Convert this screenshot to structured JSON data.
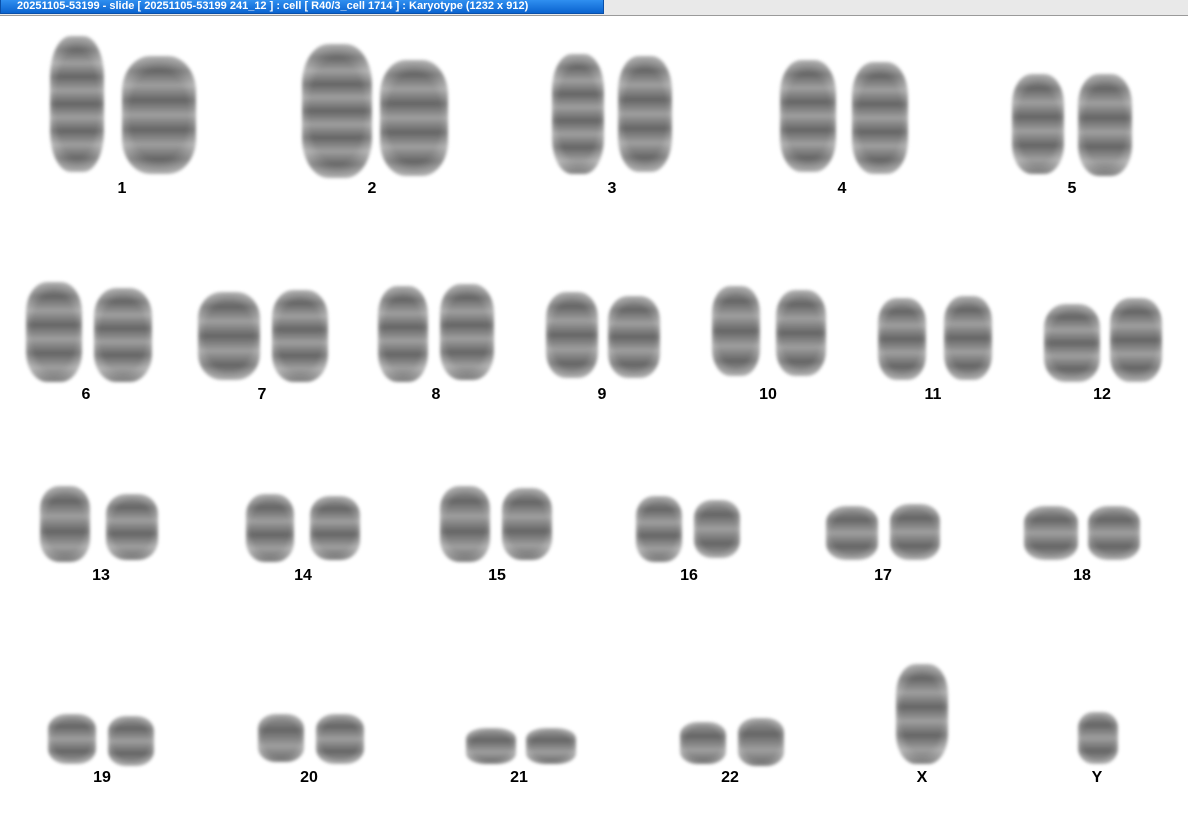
{
  "window": {
    "title": "20251105-53199 - slide [ 20251105-53199 241_12 ] : cell [ R40/3_cell 1714 ] : Karyotype  (1232 x 912)"
  },
  "karyotype": {
    "labels": [
      "1",
      "2",
      "3",
      "4",
      "5",
      "6",
      "7",
      "8",
      "9",
      "10",
      "11",
      "12",
      "13",
      "14",
      "15",
      "16",
      "17",
      "18",
      "19",
      "20",
      "21",
      "22",
      "X",
      "Y"
    ]
  }
}
